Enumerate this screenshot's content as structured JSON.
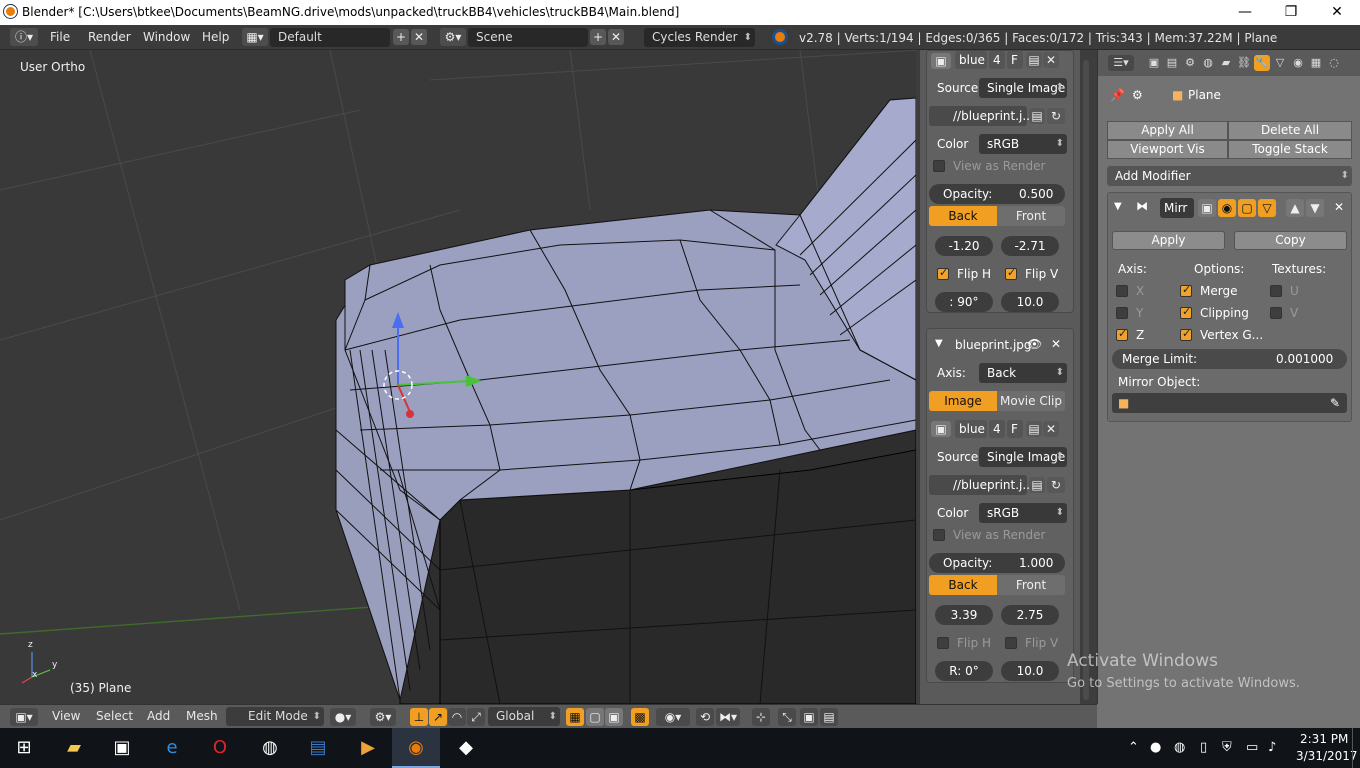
{
  "window": {
    "title": "Blender* [C:\\Users\\btkee\\Documents\\BeamNG.drive\\mods\\unpacked\\truckBB4\\vehicles\\truckBB4\\Main.blend]",
    "minimize": "—",
    "maximize": "❐",
    "close": "✕"
  },
  "info_header": {
    "menus": [
      "File",
      "Render",
      "Window",
      "Help"
    ],
    "layout": "Default",
    "scene": "Scene",
    "engine": "Cycles Render",
    "stats": "v2.78 | Verts:1/194 | Edges:0/365 | Faces:0/172 | Tris:343 | Mem:37.22M | Plane"
  },
  "viewport": {
    "view_label": "User Ortho",
    "object_label": "(35) Plane",
    "axis_x": "x",
    "axis_y": "y",
    "axis_z": "z"
  },
  "npanel": {
    "bg1": {
      "image_name": "blue",
      "users": "4",
      "fake": "F",
      "source_label": "Source",
      "source_value": "Single Image",
      "filepath": "//blueprint.j...",
      "color_label": "Color",
      "color_value": "sRGB",
      "view_as_render": "View as Render",
      "opacity_label": "Opacity:",
      "opacity_value": "0.500",
      "back": "Back",
      "front": "Front",
      "offset_x": "-1.20",
      "offset_y": "-2.71",
      "flip_h": "Flip H",
      "flip_v": "Flip V",
      "rotation": ": 90°",
      "size": "10.0"
    },
    "bg2": {
      "title": "blueprint.jpg",
      "axis_label": "Axis:",
      "axis_value": "Back",
      "tab_image": "Image",
      "tab_movie": "Movie Clip",
      "image_name": "blue",
      "users": "4",
      "fake": "F",
      "source_label": "Source",
      "source_value": "Single Image",
      "filepath": "//blueprint.j...",
      "color_label": "Color",
      "color_value": "sRGB",
      "view_as_render": "View as Render",
      "opacity_label": "Opacity:",
      "opacity_value": "1.000",
      "back": "Back",
      "front": "Front",
      "offset_x": "3.39",
      "offset_y": "2.75",
      "flip_h": "Flip H",
      "flip_v": "Flip V",
      "rotation": "R: 0°",
      "size": "10.0"
    }
  },
  "properties": {
    "object_name": "Plane",
    "apply_all": "Apply All",
    "delete_all": "Delete All",
    "viewport_vis": "Viewport Vis",
    "toggle_stack": "Toggle Stack",
    "add_modifier": "Add Modifier",
    "modifier_name": "Mirr",
    "apply": "Apply",
    "copy": "Copy",
    "axis_label": "Axis:",
    "options_label": "Options:",
    "textures_label": "Textures:",
    "axis_x": "X",
    "axis_y": "Y",
    "axis_z": "Z",
    "merge": "Merge",
    "clipping": "Clipping",
    "vertex_groups": "Vertex G...",
    "tex_u": "U",
    "tex_v": "V",
    "merge_limit_label": "Merge Limit:",
    "merge_limit_value": "0.001000",
    "mirror_object_label": "Mirror Object:"
  },
  "viewport_header": {
    "menus": [
      "View",
      "Select",
      "Add",
      "Mesh"
    ],
    "mode": "Edit Mode",
    "orientation": "Global"
  },
  "watermark": {
    "line1": "Activate Windows",
    "line2": "Go to Settings to activate Windows."
  },
  "taskbar": {
    "time": "2:31 PM",
    "date": "3/31/2017"
  },
  "colors": {
    "accent": "#f19f22",
    "mesh_face": "#9b9fc0",
    "viewport_bg": "#393939"
  }
}
